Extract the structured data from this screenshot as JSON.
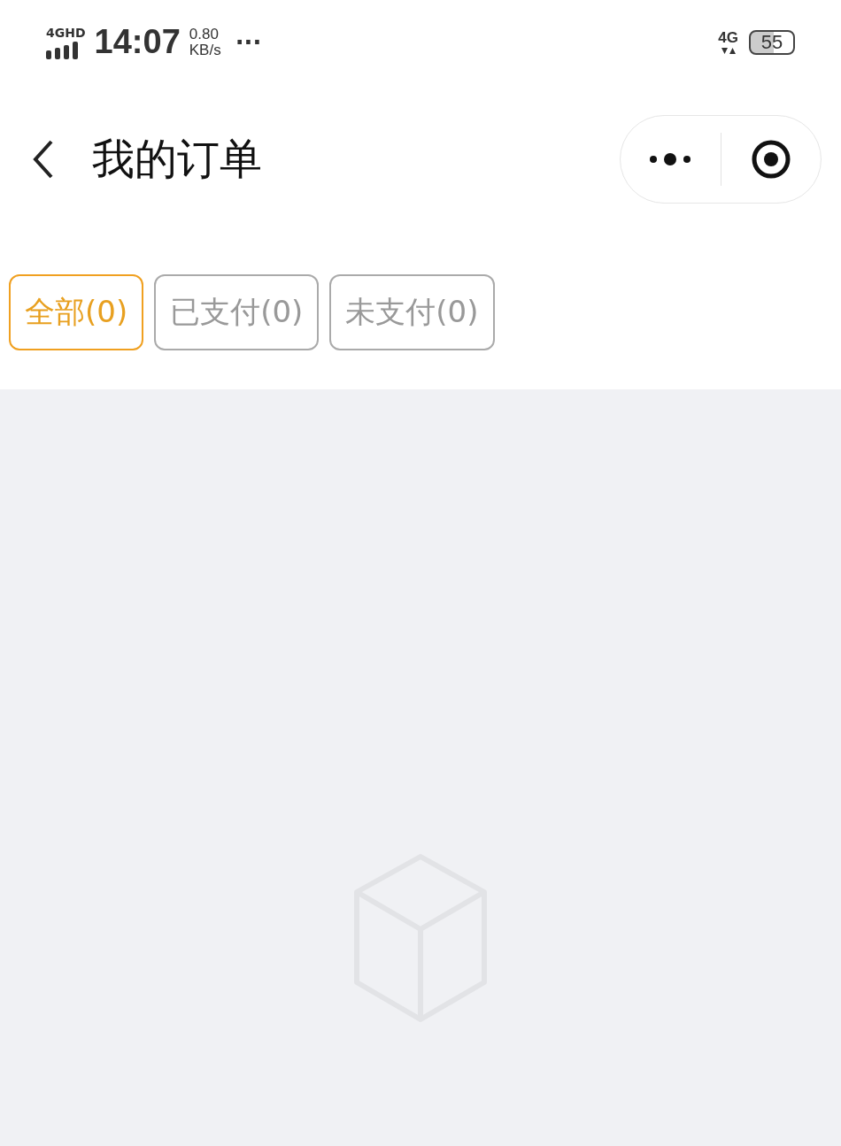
{
  "status_bar": {
    "network": "4GHD",
    "time": "14:07",
    "speed": "0.80",
    "speed_unit": "KB/s",
    "more": "···",
    "mobile": "4G",
    "battery": "55"
  },
  "nav_bar": {
    "title": "我的订单"
  },
  "tabs": [
    {
      "label": "全部(0)",
      "selected": true
    },
    {
      "label": "已支付(0)",
      "selected": false
    },
    {
      "label": "未支付(0)",
      "selected": false
    }
  ]
}
